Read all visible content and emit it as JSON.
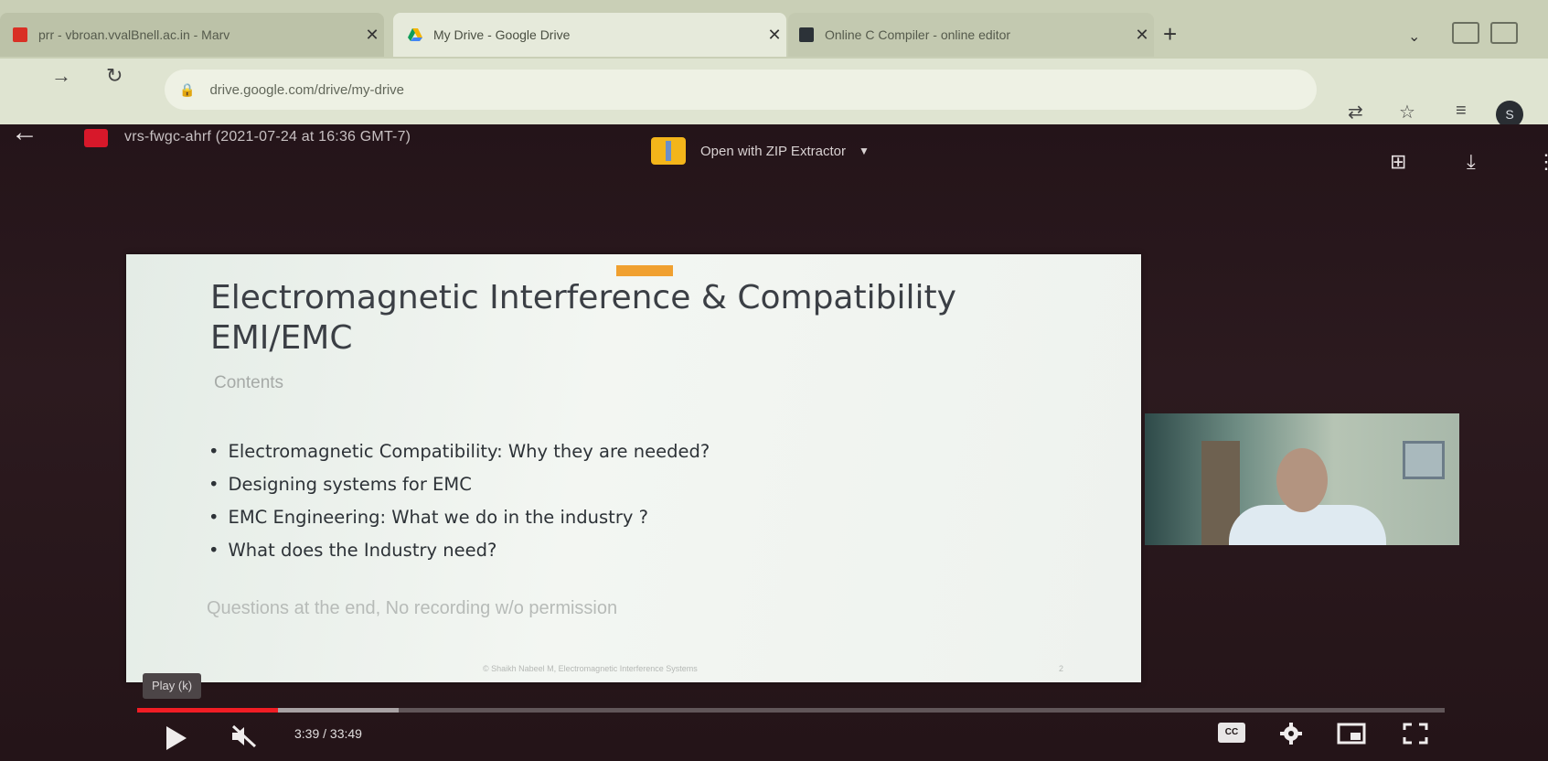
{
  "browser": {
    "tabs": [
      {
        "title": "prr - vbroan.vvalBnell.ac.in - Marv",
        "active": false
      },
      {
        "title": "My Drive - Google Drive",
        "active": true
      },
      {
        "title": "Online C Compiler - online editor",
        "active": false
      }
    ],
    "url": "drive.google.com/drive/my-drive",
    "profile_initial": "S",
    "accent": "#f01d24"
  },
  "drive_viewer": {
    "file_name": "vrs-fwgc-ahrf (2021-07-24 at 16:36 GMT-7)",
    "open_with": "Open with ZIP Extractor"
  },
  "slide": {
    "title": "Electromagnetic Interference & Compatibility EMI/EMC",
    "subtitle": "Contents",
    "bullets": [
      "Electromagnetic Compatibility: Why they are needed?",
      "Designing systems for EMC",
      "EMC Engineering: What we do in the industry ?",
      "What does the Industry need?"
    ],
    "note": "Questions at the end, No recording w/o permission",
    "footer": "© Shaikh Nabeel M, Electromagnetic Interference Systems",
    "page_number": "2"
  },
  "player": {
    "tooltip": "Play (k)",
    "time": "3:39 / 33:49",
    "cc_label": "CC",
    "progress_played": 0.108,
    "progress_buffered": 0.2
  },
  "icons": [
    "back-arrow-icon",
    "pdf-file-icon",
    "zip-extractor-icon",
    "add-to-drive-icon",
    "download-icon",
    "more-icon",
    "play-icon",
    "mute-icon",
    "captions-icon",
    "settings-icon",
    "miniplayer-icon",
    "fullscreen-icon"
  ]
}
